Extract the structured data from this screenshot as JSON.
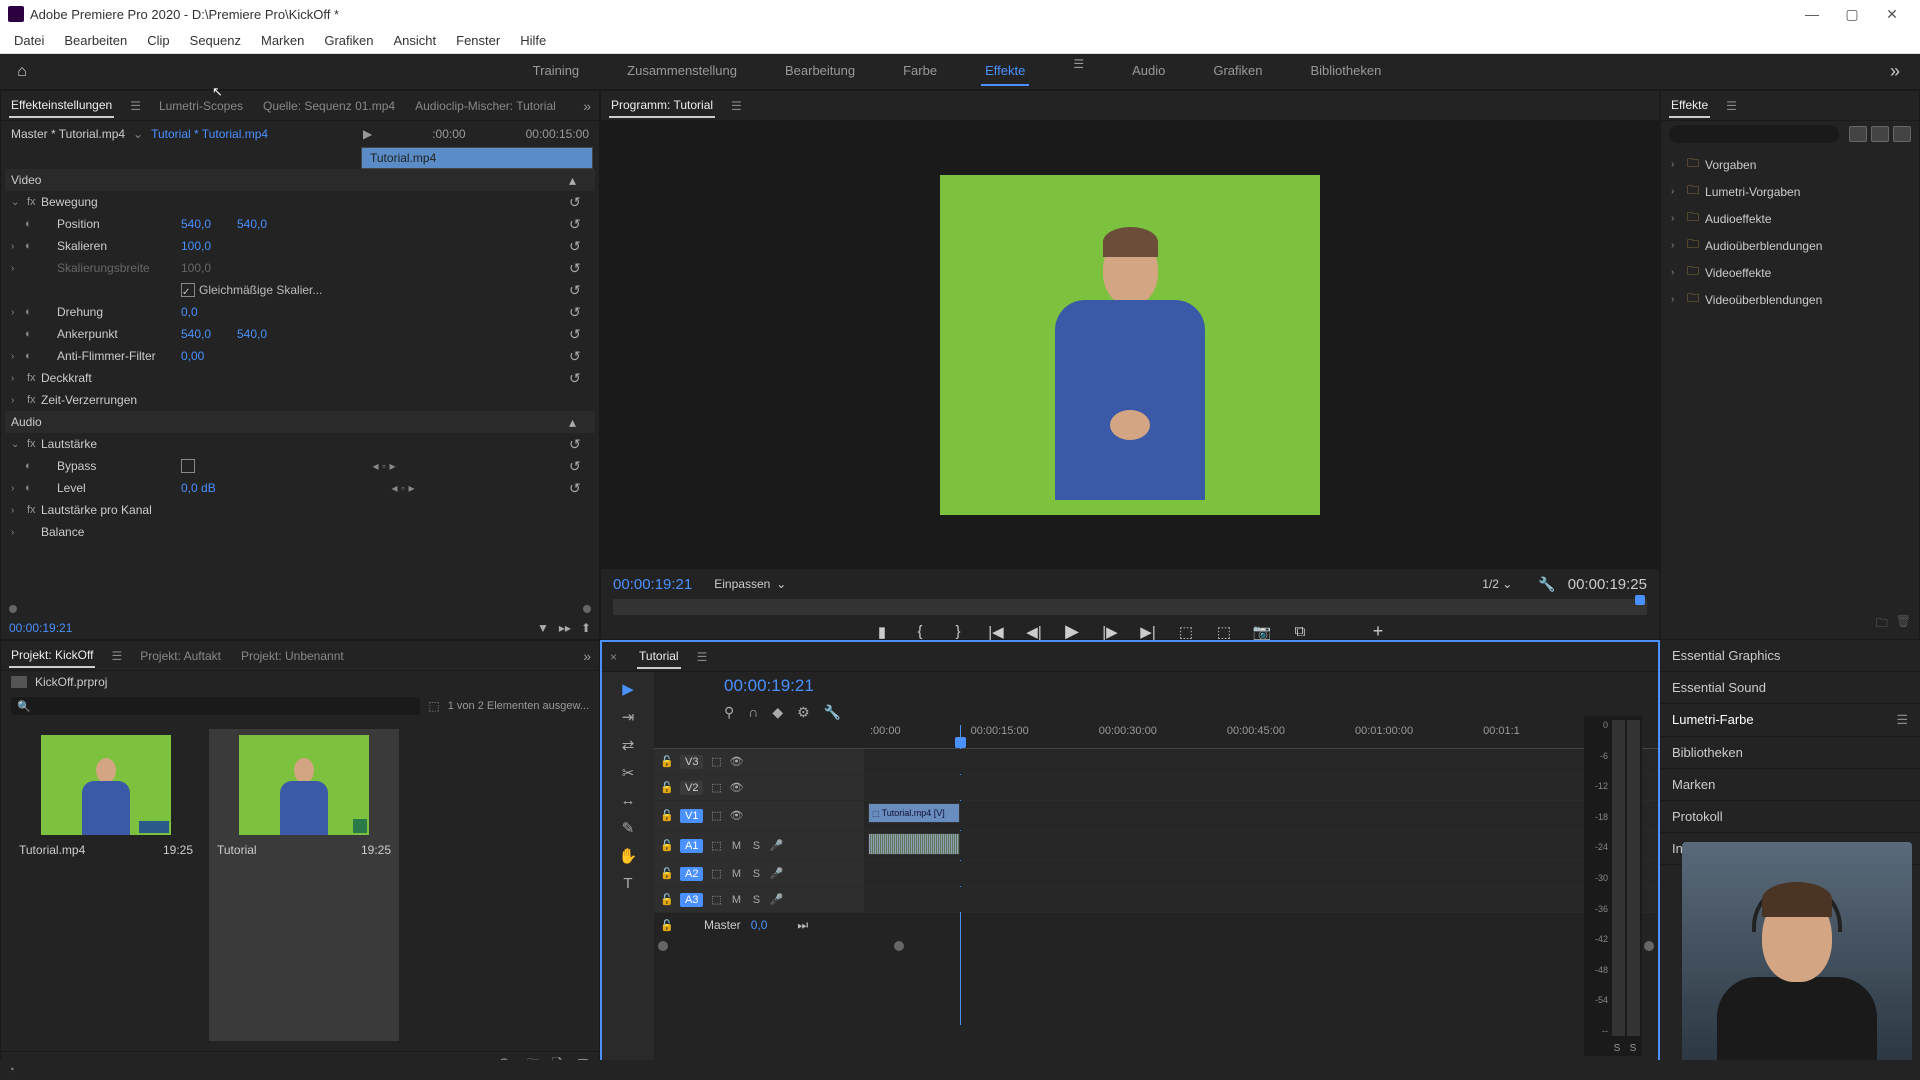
{
  "title": "Adobe Premiere Pro 2020 - D:\\Premiere Pro\\KickOff *",
  "menu": [
    "Datei",
    "Bearbeiten",
    "Clip",
    "Sequenz",
    "Marken",
    "Grafiken",
    "Ansicht",
    "Fenster",
    "Hilfe"
  ],
  "workspaces": {
    "items": [
      "Training",
      "Zusammenstellung",
      "Bearbeitung",
      "Farbe",
      "Effekte",
      "Audio",
      "Grafiken",
      "Bibliotheken"
    ],
    "active": "Effekte"
  },
  "effect_controls": {
    "tabs": [
      "Effekteinstellungen",
      "Lumetri-Scopes",
      "Quelle: Sequenz 01.mp4",
      "Audioclip-Mischer: Tutorial"
    ],
    "active_tab": "Effekteinstellungen",
    "master": "Master * Tutorial.mp4",
    "clip": "Tutorial * Tutorial.mp4",
    "time_start": ":00:00",
    "time_end": "00:00:15:00",
    "clip_bar": "Tutorial.mp4",
    "video_section": "Video",
    "bewegung": "Bewegung",
    "position_label": "Position",
    "position_x": "540,0",
    "position_y": "540,0",
    "skalieren_label": "Skalieren",
    "skalieren_val": "100,0",
    "skalierungsbreite_label": "Skalierungsbreite",
    "skalierungsbreite_val": "100,0",
    "gleichmassig": "Gleichmäßige Skalier...",
    "drehung_label": "Drehung",
    "drehung_val": "0,0",
    "ankerpunkt_label": "Ankerpunkt",
    "ankerpunkt_x": "540,0",
    "ankerpunkt_y": "540,0",
    "antiflimmer_label": "Anti-Flimmer-Filter",
    "antiflimmer_val": "0,00",
    "deckkraft": "Deckkraft",
    "zeit": "Zeit-Verzerrungen",
    "audio_section": "Audio",
    "lautstarke": "Lautstärke",
    "bypass_label": "Bypass",
    "level_label": "Level",
    "level_val": "0,0 dB",
    "lautstarke_kanal": "Lautstärke pro Kanal",
    "balance": "Balance",
    "timecode": "00:00:19:21"
  },
  "program": {
    "tab": "Programm: Tutorial",
    "timecode": "00:00:19:21",
    "fit": "Einpassen",
    "zoom": "1/2",
    "duration": "00:00:19:25"
  },
  "effects": {
    "tab": "Effekte",
    "search_placeholder": "",
    "folders": [
      "Vorgaben",
      "Lumetri-Vorgaben",
      "Audioeffekte",
      "Audioüberblendungen",
      "Videoeffekte",
      "Videoüberblendungen"
    ]
  },
  "project": {
    "tabs": [
      "Projekt: KickOff",
      "Projekt: Auftakt",
      "Projekt: Unbenannt"
    ],
    "active_tab": "Projekt: KickOff",
    "filename": "KickOff.prproj",
    "count": "1 von 2 Elementen ausgew...",
    "items": [
      {
        "name": "Tutorial.mp4",
        "duration": "19:25",
        "selected": false,
        "type": "clip"
      },
      {
        "name": "Tutorial",
        "duration": "19:25",
        "selected": true,
        "type": "sequence"
      }
    ]
  },
  "timeline": {
    "tab": "Tutorial",
    "timecode": "00:00:19:21",
    "ruler": [
      ":00:00",
      "00:00:15:00",
      "00:00:30:00",
      "00:00:45:00",
      "00:01:00:00",
      "00:01:1"
    ],
    "v3": "V3",
    "v2": "V2",
    "v1": "V1",
    "a1": "A1",
    "a2": "A2",
    "a3": "A3",
    "master": "Master",
    "master_val": "0,0",
    "clip_name": "Tutorial.mp4 [V]"
  },
  "right_panels": [
    "Essential Graphics",
    "Essential Sound",
    "Lumetri-Farbe",
    "Bibliotheken",
    "Marken",
    "Protokoll",
    "Informationen"
  ],
  "right_panels_active": "Lumetri-Farbe",
  "meter_labels": [
    "0",
    "-6",
    "-12",
    "-18",
    "-24",
    "-30",
    "-36",
    "-42",
    "-48",
    "-54",
    "--"
  ],
  "meter_s": "S"
}
